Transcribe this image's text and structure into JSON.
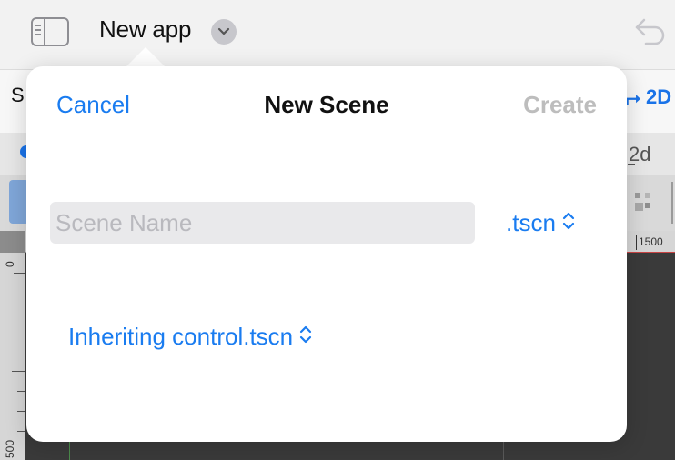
{
  "header": {
    "app_title": "New app",
    "icons": [
      "sidebar-toggle-icon",
      "chevron-down-icon",
      "undo-icon"
    ]
  },
  "background": {
    "partial_label": "S",
    "mode_button_label": "2D",
    "tab_label": "2d",
    "ruler_top_label": "1500",
    "ruler_left_zero": "0",
    "ruler_left_500": "500"
  },
  "dialog": {
    "title": "New Scene",
    "cancel_label": "Cancel",
    "create_label": "Create",
    "scene_name": {
      "value": "",
      "placeholder": "Scene Name"
    },
    "extension": ".tscn",
    "inherit_label": "Inheriting control.tscn"
  },
  "colors": {
    "accent": "#1a7cf0",
    "disabled": "#bdbdbd",
    "viewport": "#3a3a3a"
  }
}
